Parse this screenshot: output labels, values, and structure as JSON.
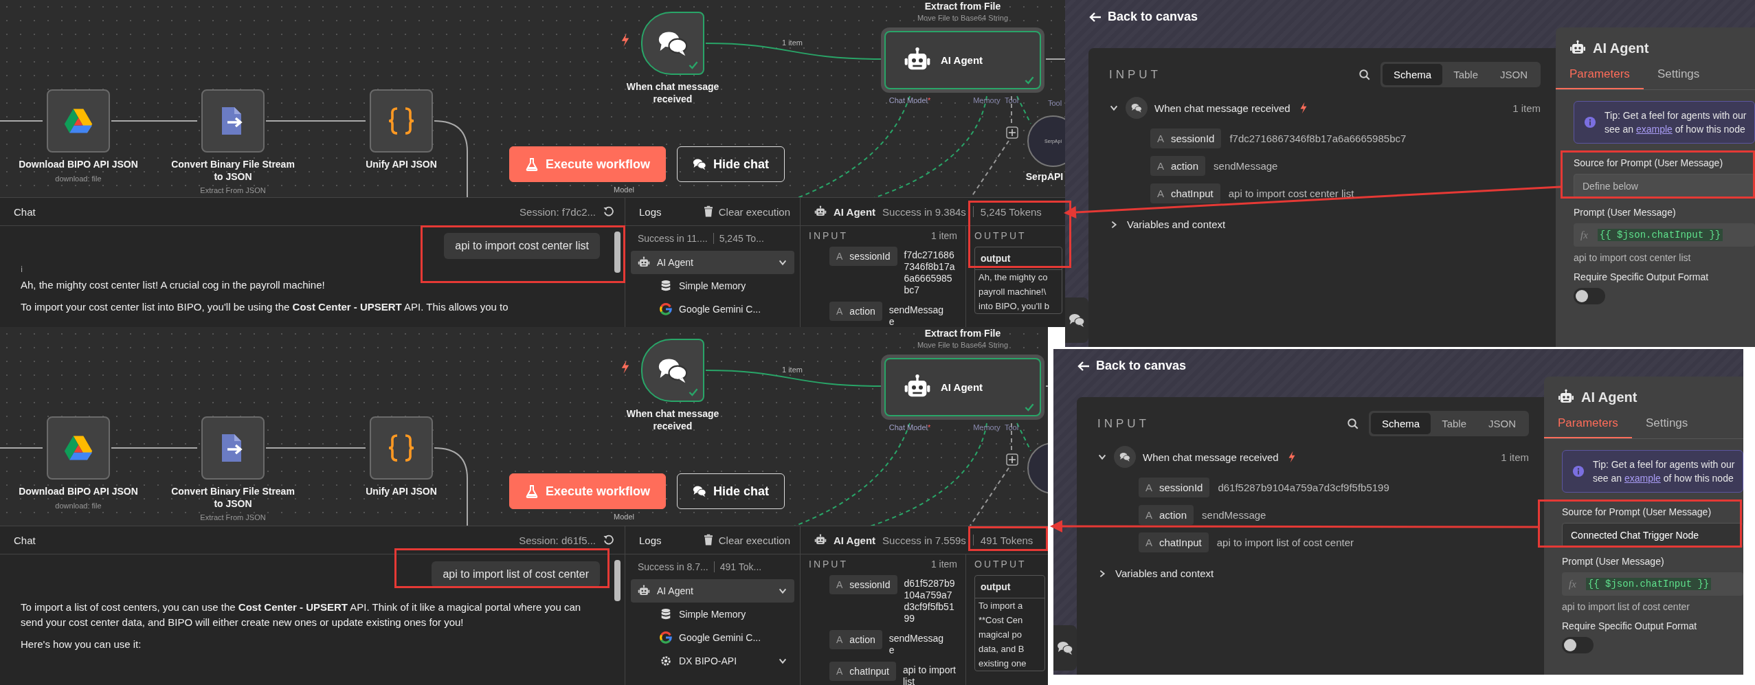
{
  "editors": [
    {
      "canvas": {
        "nodes": [
          {
            "kind": "drive",
            "label": "Download BIPO API JSON",
            "subtitle": "download: file"
          },
          {
            "kind": "convert",
            "label": "Convert Binary File Stream to JSON",
            "subtitle": "Extract From JSON"
          },
          {
            "kind": "code",
            "label": "Unify API JSON"
          },
          {
            "kind": "trigger",
            "label": "When chat message received",
            "done": true
          },
          {
            "kind": "agent",
            "label": "AI Agent",
            "title": "Extract from File",
            "subtitle": "Move File to Base64 String",
            "done": true,
            "ports": [
              {
                "label": "Chat Model",
                "required": true,
                "mark": "*"
              },
              {
                "label": "Memory",
                "required": false
              },
              {
                "label": "Tool",
                "required": false
              }
            ]
          },
          {
            "kind": "tool",
            "caption": "SerpApi",
            "label": "SerpAPI",
            "port": "Tool"
          }
        ],
        "connection_label": "1 item",
        "model_label": "Model",
        "buttons": [
          {
            "kind": "primary",
            "label": "Execute workflow"
          },
          {
            "kind": "secondary",
            "label": "Hide chat"
          }
        ]
      },
      "chat": {
        "title": "Chat",
        "session": "Session: f7dc2...",
        "user_message": "api to import cost center list",
        "info": "ℹ",
        "reply": [
          "Ah, the mighty cost center list! A crucial cog in the payroll machine!",
          "To import your cost center list into BIPO, you'll be using the **Cost Center - UPSERT** API. This allows you to"
        ]
      },
      "logs": {
        "title": "Logs",
        "clear": "Clear execution",
        "summary": "Success in 11....",
        "tokens": "5,245 To...",
        "items": [
          {
            "kind": "agent",
            "label": "AI Agent",
            "selected": true,
            "expanded": true
          },
          {
            "kind": "memory",
            "label": "Simple Memory",
            "selected": false
          },
          {
            "kind": "gemini",
            "label": "Google Gemini C...",
            "selected": false
          }
        ]
      },
      "run": {
        "node": "AI Agent",
        "status": "Success in 9.384s",
        "tokens": "5,245 Tokens",
        "input_title": "INPUT",
        "input_count": "1 item",
        "output_title": "OUTPUT",
        "fields": [
          {
            "type": "A",
            "name": "sessionId",
            "value": "f7dc2716867346f8b17a6a6665985bc7"
          },
          {
            "type": "A",
            "name": "action",
            "value": "sendMessage"
          }
        ],
        "output_key": "output",
        "output_lines": [
          "Ah, the mighty co",
          "payroll machine!\\",
          "into BIPO, you'll b"
        ]
      }
    },
    {
      "canvas": {
        "nodes": [
          {
            "kind": "drive",
            "label": "Download BIPO API JSON",
            "subtitle": "download: file"
          },
          {
            "kind": "convert",
            "label": "Convert Binary File Stream to JSON",
            "subtitle": "Extract From JSON"
          },
          {
            "kind": "code",
            "label": "Unify API JSON"
          },
          {
            "kind": "trigger",
            "label": "When chat message received",
            "done": true
          },
          {
            "kind": "agent",
            "label": "AI Agent",
            "title": "Extract from File",
            "subtitle": "Move File to Base64 String",
            "done": true,
            "ports": [
              {
                "label": "Chat Model",
                "required": true,
                "mark": "*"
              },
              {
                "label": "Memory",
                "required": false
              },
              {
                "label": "Tool",
                "required": false
              }
            ]
          },
          {
            "kind": "tool"
          }
        ],
        "connection_label": "1 item",
        "model_label": "Model",
        "buttons": [
          {
            "kind": "primary",
            "label": "Execute workflow"
          },
          {
            "kind": "secondary",
            "label": "Hide chat"
          }
        ]
      },
      "chat": {
        "title": "Chat",
        "session": "Session: d61f5...",
        "user_message": "api to import list of cost center",
        "reply": [
          "To import a list of cost centers, you can use the **Cost Center - UPSERT** API. Think of it like a magical portal where you can send your cost center data, and BIPO will either create new ones or update existing ones for you!",
          "Here's how you can use it:"
        ]
      },
      "logs": {
        "title": "Logs",
        "clear": "Clear execution",
        "summary": "Success in 8.7...",
        "tokens": "491 Tok...",
        "items": [
          {
            "kind": "agent",
            "label": "AI Agent",
            "selected": true,
            "expanded": true
          },
          {
            "kind": "memory",
            "label": "Simple Memory",
            "selected": false
          },
          {
            "kind": "gemini",
            "label": "Google Gemini C...",
            "selected": false
          },
          {
            "kind": "api",
            "label": "DX BIPO-API",
            "selected": false,
            "expanded": true
          }
        ]
      },
      "run": {
        "node": "AI Agent",
        "status": "Success in 7.559s",
        "tokens": "491 Tokens",
        "input_title": "INPUT",
        "input_count": "1 item",
        "output_title": "OUTPUT",
        "fields": [
          {
            "type": "A",
            "name": "sessionId",
            "value": "d61f5287b9104a759a7d3cf9f5fb5199"
          },
          {
            "type": "A",
            "name": "action",
            "value": "sendMessage"
          },
          {
            "type": "A",
            "name": "chatInput",
            "value": "api to import list"
          }
        ],
        "output_key": "output",
        "output_lines": [
          "To import a",
          "**Cost Cen",
          "magical po",
          "data, and B",
          "existing one"
        ]
      }
    }
  ],
  "ndvs": [
    {
      "back": "Back to canvas",
      "input": {
        "title": "INPUT",
        "views": [
          {
            "label": "Schema",
            "selected": true
          },
          {
            "label": "Table",
            "selected": false
          },
          {
            "label": "JSON",
            "selected": false
          }
        ],
        "source": "When chat message received",
        "count": "1 item",
        "expanded": true,
        "fields": [
          {
            "type": "A",
            "name": "sessionId",
            "value": "f7dc2716867346f8b17a6a6665985bc7"
          },
          {
            "type": "A",
            "name": "action",
            "value": "sendMessage"
          },
          {
            "type": "A",
            "name": "chatInput",
            "value": "api to import cost center list"
          }
        ],
        "variables": "Variables and context",
        "variables_expanded": false
      },
      "params": {
        "title": "AI Agent",
        "tabs": [
          {
            "label": "Parameters",
            "selected": true
          },
          {
            "label": "Settings",
            "selected": false
          }
        ],
        "tip_first": "Tip: Get a feel for agents with our",
        "tip_before": "see an",
        "tip_link": "example",
        "tip_after": "of how this node",
        "source_label": "Source for Prompt (User Message)",
        "source_value": "Define below",
        "prompt_label": "Prompt (User Message)",
        "prompt_prefix": "fx",
        "prompt_value": "{{ $json.chatInput }}",
        "prompt_preview": "api to import cost center list",
        "format_label": "Require Specific Output Format",
        "format_on": false
      }
    },
    {
      "back": "Back to canvas",
      "input": {
        "title": "INPUT",
        "views": [
          {
            "label": "Schema",
            "selected": true
          },
          {
            "label": "Table",
            "selected": false
          },
          {
            "label": "JSON",
            "selected": false
          }
        ],
        "source": "When chat message received",
        "count": "1 item",
        "expanded": true,
        "fields": [
          {
            "type": "A",
            "name": "sessionId",
            "value": "d61f5287b9104a759a7d3cf9f5fb5199"
          },
          {
            "type": "A",
            "name": "action",
            "value": "sendMessage"
          },
          {
            "type": "A",
            "name": "chatInput",
            "value": "api to import list of cost center"
          }
        ],
        "variables": "Variables and context",
        "variables_expanded": false
      },
      "params": {
        "title": "AI Agent",
        "tabs": [
          {
            "label": "Parameters",
            "selected": true
          },
          {
            "label": "Settings",
            "selected": false
          }
        ],
        "tip_first": "Tip: Get a feel for agents with our",
        "tip_before": "see an",
        "tip_link": "example",
        "tip_after": "of how this node",
        "source_label": "Source for Prompt (User Message)",
        "source_value": "Connected Chat Trigger Node",
        "prompt_label": "Prompt (User Message)",
        "prompt_prefix": "fx",
        "prompt_value": "{{ $json.chatInput }}",
        "prompt_preview": "api to import list of cost center",
        "format_label": "Require Specific Output Format",
        "format_on": false
      }
    }
  ]
}
